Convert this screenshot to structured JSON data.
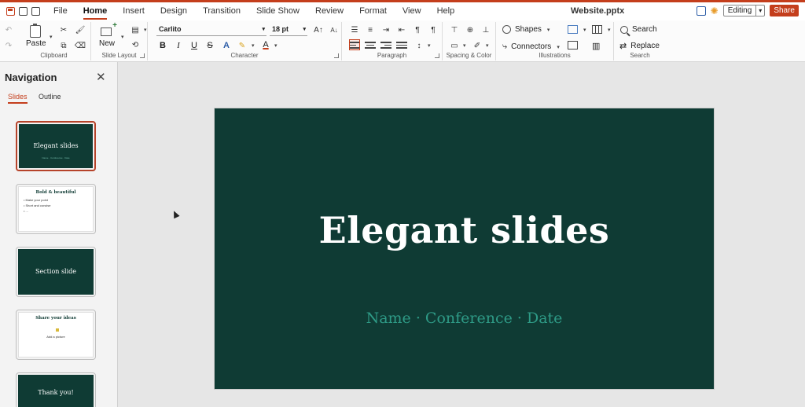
{
  "app": {
    "document_title": "Website.pptx",
    "accent_color": "#c43e1c",
    "slide_background": "#0f3b34",
    "slide_subtitle_color": "#2e9a86"
  },
  "menubar": {
    "tabs": [
      {
        "label": "File"
      },
      {
        "label": "Home",
        "active": true
      },
      {
        "label": "Insert"
      },
      {
        "label": "Design"
      },
      {
        "label": "Transition"
      },
      {
        "label": "Slide Show"
      },
      {
        "label": "Review"
      },
      {
        "label": "Format"
      },
      {
        "label": "View"
      },
      {
        "label": "Help"
      }
    ],
    "editing_mode": "Editing",
    "share_label": "Share"
  },
  "ribbon": {
    "clipboard": {
      "group_label": "Clipboard",
      "paste_label": "Paste"
    },
    "slides": {
      "group_label": "Slide Layout",
      "new_label": "New"
    },
    "character": {
      "group_label": "Character",
      "font_name": "Carlito",
      "font_size": "18 pt",
      "bold": "B",
      "italic": "I",
      "underline": "U",
      "strike": "S",
      "text_effect": "A",
      "font_color": "A"
    },
    "paragraph": {
      "group_label": "Paragraph"
    },
    "spacing": {
      "group_label": "Spacing & Color"
    },
    "illustrations": {
      "group_label": "Illustrations",
      "shapes_label": "Shapes",
      "connectors_label": "Connectors"
    },
    "search": {
      "group_label": "Search",
      "search_label": "Search",
      "replace_label": "Replace"
    }
  },
  "navigation": {
    "title": "Navigation",
    "tabs": [
      {
        "label": "Slides",
        "active": true
      },
      {
        "label": "Outline"
      }
    ],
    "thumbnails": [
      {
        "title": "Elegant slides",
        "subtitle": "Name · Conference · Date",
        "style": "dark",
        "selected": true
      },
      {
        "title": "Bold & beautiful",
        "bullets": [
          "Make your point",
          "Short and concise",
          "..."
        ],
        "style": "light"
      },
      {
        "title": "Section slide",
        "style": "dark"
      },
      {
        "title": "Share your ideas",
        "caption": "Add a picture",
        "style": "light"
      },
      {
        "title": "Thank you!",
        "style": "dark"
      }
    ]
  },
  "slide": {
    "title": "Elegant slides",
    "subtitle": "Name · Conference · Date"
  }
}
